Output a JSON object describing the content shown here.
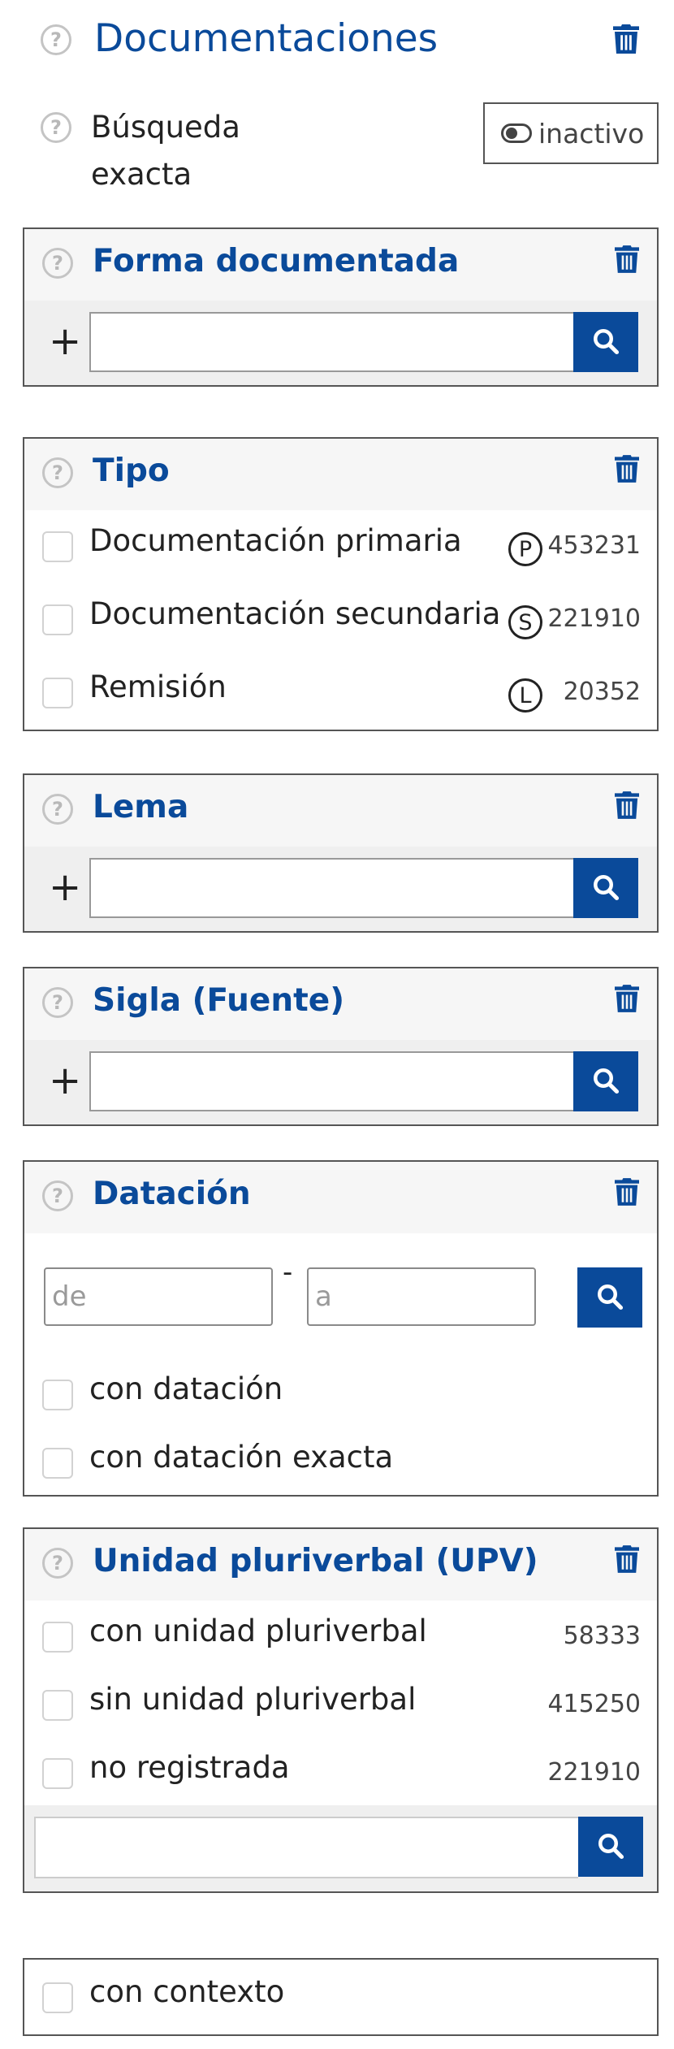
{
  "page": {
    "title": "Documentaciones",
    "help_glyph": "?",
    "delete_icon": "trash-icon"
  },
  "exact_search": {
    "label": "Búsqueda exacta",
    "toggle_state": "inactivo",
    "enabled": false
  },
  "forma": {
    "title": "Forma documentada",
    "add_glyph": "+",
    "value": ""
  },
  "tipo": {
    "title": "Tipo",
    "items": [
      {
        "label": "Documentación primaria",
        "badge": "P",
        "count": "453231",
        "checked": false
      },
      {
        "label": "Documentación secundaria",
        "badge": "S",
        "count": "221910",
        "checked": false
      },
      {
        "label": "Remisión",
        "badge": "L",
        "count": "20352",
        "checked": false
      }
    ]
  },
  "lema": {
    "title": "Lema",
    "add_glyph": "+",
    "value": ""
  },
  "sigla": {
    "title": "Sigla (Fuente)",
    "add_glyph": "+",
    "value": ""
  },
  "datacion": {
    "title": "Datación",
    "from_placeholder": "de",
    "to_placeholder": "a",
    "separator": "-",
    "options": [
      {
        "label": "con datación",
        "checked": false
      },
      {
        "label": "con datación exacta",
        "checked": false
      }
    ]
  },
  "upv": {
    "title": "Unidad pluriverbal (UPV)",
    "items": [
      {
        "label": "con unidad pluriverbal",
        "count": "58333",
        "checked": false
      },
      {
        "label": "sin unidad pluriverbal",
        "count": "415250",
        "checked": false
      },
      {
        "label": "no registrada",
        "count": "221910",
        "checked": false
      }
    ],
    "value": ""
  },
  "contexto": {
    "label": "con contexto",
    "checked": false
  },
  "colors": {
    "accent": "#0a4a9a",
    "border": "#555555",
    "header_bg": "#f6f6f6",
    "input_row_bg": "#efefef"
  }
}
